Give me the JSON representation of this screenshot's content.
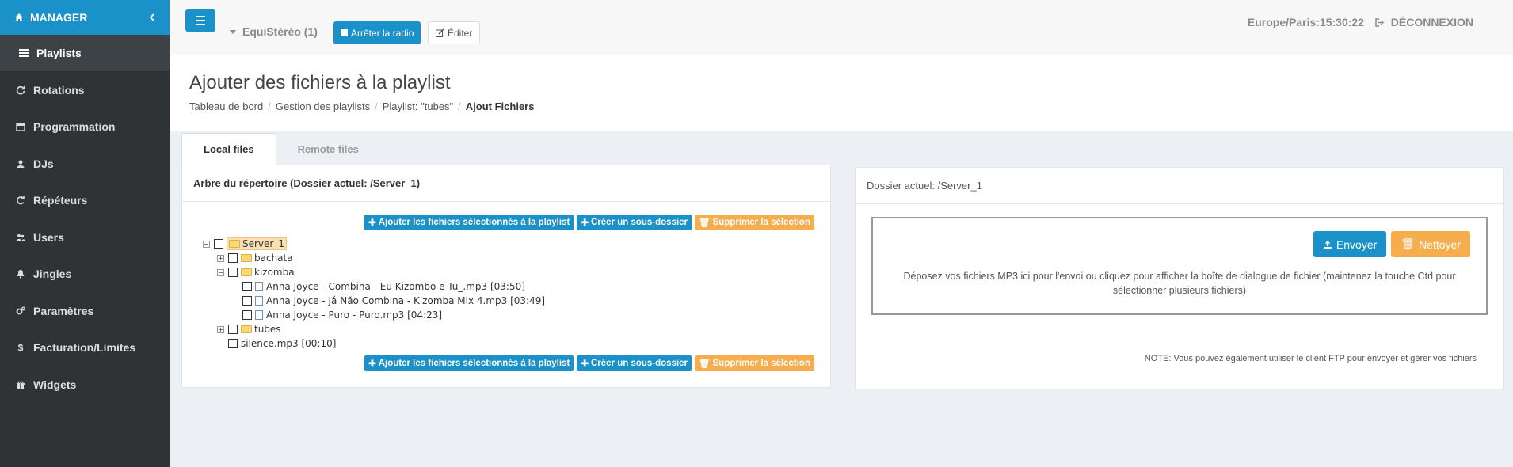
{
  "sidebar": {
    "title": "MANAGER",
    "items": [
      {
        "label": "Playlists",
        "icon": "list-icon"
      },
      {
        "label": "Rotations",
        "icon": "refresh-icon"
      },
      {
        "label": "Programmation",
        "icon": "calendar-icon"
      },
      {
        "label": "DJs",
        "icon": "user-icon"
      },
      {
        "label": "Répéteurs",
        "icon": "repeat-icon"
      },
      {
        "label": "Users",
        "icon": "users-icon"
      },
      {
        "label": "Jingles",
        "icon": "bell-icon"
      },
      {
        "label": "Paramètres",
        "icon": "cogs-icon"
      },
      {
        "label": "Facturation/Limites",
        "icon": "dollar-icon"
      },
      {
        "label": "Widgets",
        "icon": "gift-icon"
      }
    ]
  },
  "topbar": {
    "radio_name": "EquiStéréo (1)",
    "stop_label": "Arrêter la radio",
    "edit_label": "Éditer",
    "clock": "Europe/Paris:15:30:22",
    "logout_label": "DÉCONNEXION"
  },
  "header": {
    "title": "Ajouter des fichiers à la playlist",
    "breadcrumb": [
      "Tableau de bord",
      "Gestion des playlists",
      "Playlist: \"tubes\"",
      "Ajout Fichiers"
    ]
  },
  "tabs": [
    "Local files",
    "Remote files"
  ],
  "left_panel": {
    "title": "Arbre du répertoire (Dossier actuel: /Server_1)",
    "btn_add": "Ajouter les fichiers sélectionnés à la playlist",
    "btn_create": "Créer un sous-dossier",
    "btn_delete": "Supprimer la sélection",
    "tree": {
      "root": "Server_1",
      "bachata": "bachata",
      "kizomba": "kizomba",
      "file1": "Anna Joyce - Combina - Eu Kizombo e Tu_.mp3 [03:50]",
      "file2": "Anna Joyce - Já Não Combina - Kizomba Mix 4.mp3 [03:49]",
      "file3": "Anna Joyce - Puro - Puro.mp3 [04:23]",
      "tubes": "tubes",
      "silence": "silence.mp3 [00:10]"
    }
  },
  "right_panel": {
    "title": "Dossier actuel: /Server_1",
    "upload_label": "Envoyer",
    "clean_label": "Nettoyer",
    "drop_text": "Déposez vos fichiers MP3 ici pour l'envoi ou cliquez pour afficher la boîte de dialogue de fichier (maintenez la touche Ctrl pour sélectionner plusieurs fichiers)",
    "note": "NOTE: Vous pouvez également utiliser le client FTP pour envoyer et gérer vos fichiers"
  },
  "colors": {
    "primary": "#1b91c9",
    "warning": "#f5ad4e",
    "sidebar_bg": "#2f3336"
  }
}
